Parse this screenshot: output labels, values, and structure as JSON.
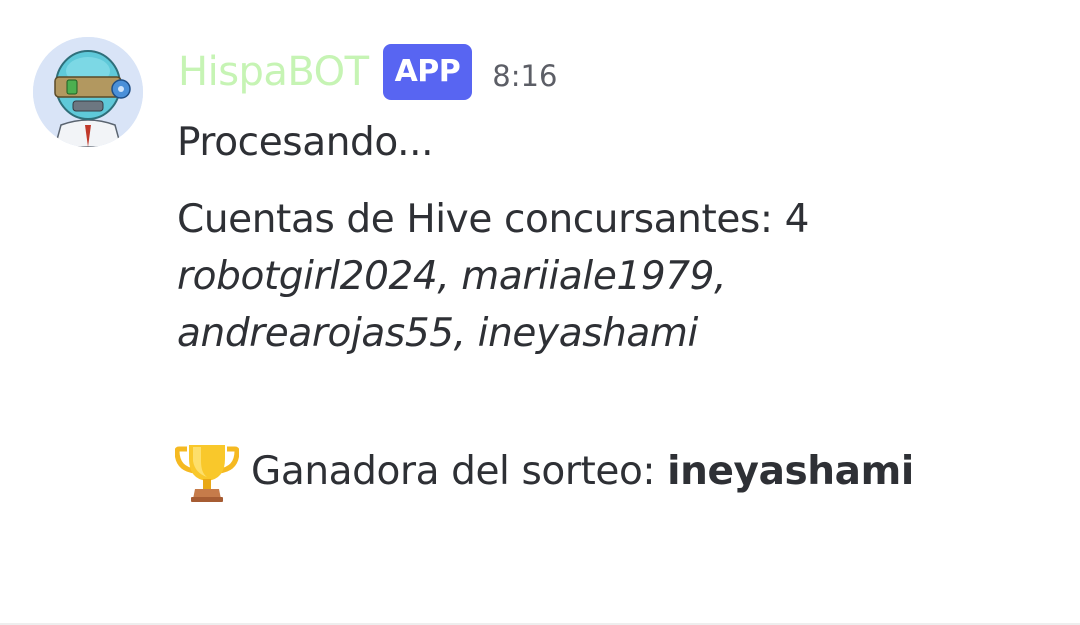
{
  "message": {
    "author": "HispaBOT",
    "badge": "APP",
    "timestamp": "8:16",
    "avatar_icon": "robot-avatar",
    "processing_text": "Procesando...",
    "accounts_label": "Cuentas de Hive concursantes: 4",
    "accounts_line1": "robotgirl2024, mariiale1979,",
    "accounts_line2": "andrearojas55, ineyashami",
    "winner_icon": "trophy-icon",
    "winner_label": "Ganadora del sorteo: ",
    "winner_name": "ineyashami"
  },
  "colors": {
    "username": "#c6f4b4",
    "badge_background": "#5865f2",
    "text": "#2e3035",
    "timestamp": "#5c5e66"
  }
}
